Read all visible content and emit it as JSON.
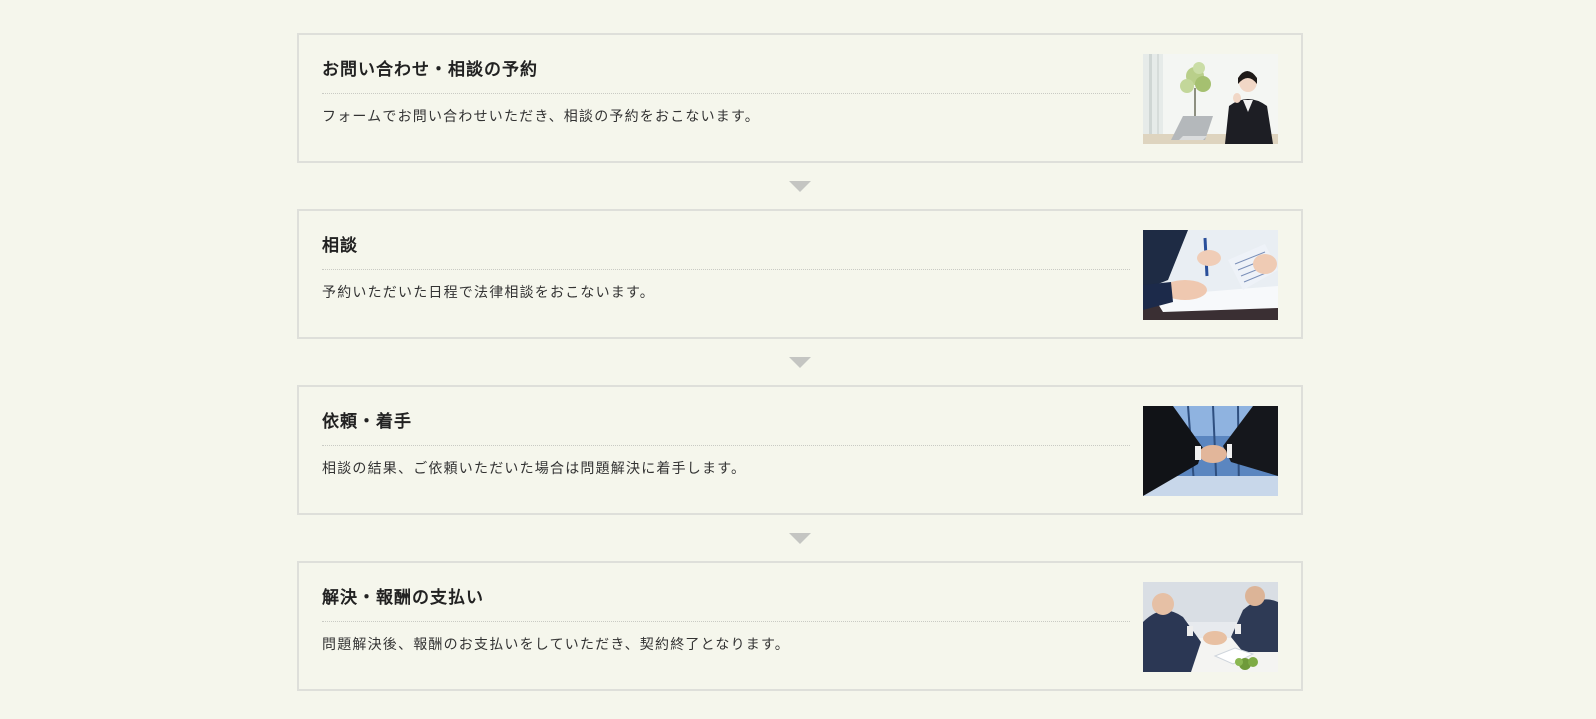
{
  "steps": [
    {
      "title": "お問い合わせ・相談の予約",
      "description": "フォームでお問い合わせいただき、相談の予約をおこないます。",
      "photo": "operator-headset-photo"
    },
    {
      "title": "相談",
      "description": "予約いただいた日程で法律相談をおこないます。",
      "photo": "document-pen-consultation-photo"
    },
    {
      "title": "依頼・着手",
      "description": "相談の結果、ご依頼いただいた場合は問題解決に着手します。",
      "photo": "business-handshake-photo"
    },
    {
      "title": "解決・報酬の支払い",
      "description": "問題解決後、報酬のお支払いをしていただき、契約終了となります。",
      "photo": "meeting-handshake-photo"
    }
  ],
  "connector_icon": "triangle-down-icon",
  "colors": {
    "background": "#f5f6ec",
    "border": "#dedfda",
    "arrow": "#c4c5c2"
  }
}
